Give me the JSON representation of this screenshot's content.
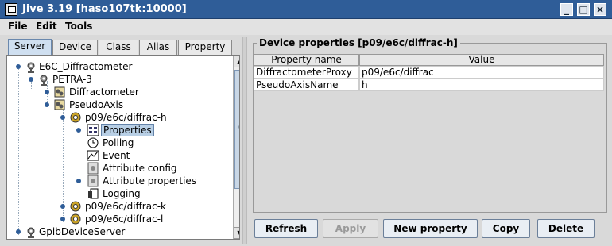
{
  "window": {
    "title": "Jive 3.19  [haso107tk:10000]"
  },
  "menu": [
    "File",
    "Edit",
    "Tools"
  ],
  "tabs": [
    "Server",
    "Device",
    "Class",
    "Alias",
    "Property"
  ],
  "tree": {
    "items": [
      {
        "label": "E6C_Diffractometer",
        "icon": "server-icon"
      },
      {
        "label": "PETRA-3",
        "icon": "server-icon"
      },
      {
        "label": "Diffractometer",
        "icon": "class-icon"
      },
      {
        "label": "PseudoAxis",
        "icon": "class-icon"
      },
      {
        "label": "p09/e6c/diffrac-h",
        "icon": "device-gear-icon"
      },
      {
        "label": "Properties",
        "icon": "properties-icon"
      },
      {
        "label": "Polling",
        "icon": "polling-clock-icon"
      },
      {
        "label": "Event",
        "icon": "event-icon"
      },
      {
        "label": "Attribute config",
        "icon": "attribute-config-icon"
      },
      {
        "label": "Attribute properties",
        "icon": "attribute-properties-icon"
      },
      {
        "label": "Logging",
        "icon": "logging-icon"
      },
      {
        "label": "p09/e6c/diffrac-k",
        "icon": "device-gear-icon"
      },
      {
        "label": "p09/e6c/diffrac-l",
        "icon": "device-gear-icon"
      },
      {
        "label": "GpibDeviceServer",
        "icon": "server-icon"
      }
    ]
  },
  "device_properties": {
    "title": "Device properties [p09/e6c/diffrac-h]",
    "columns": [
      "Property name",
      "Value"
    ],
    "rows": [
      [
        "DiffractometerProxy",
        "p09/e6c/diffrac"
      ],
      [
        "PseudoAxisName",
        "h"
      ]
    ]
  },
  "buttons": {
    "refresh": "Refresh",
    "apply": "Apply",
    "new_property": "New property",
    "copy": "Copy",
    "delete": "Delete"
  }
}
